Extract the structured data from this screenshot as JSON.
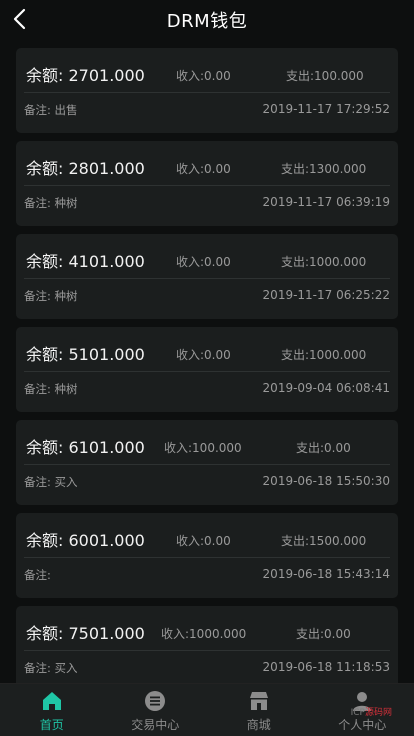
{
  "header": {
    "title": "DRM钱包"
  },
  "records": [
    {
      "balance_label": "余额:",
      "balance": "2701.000",
      "income_label": "收入:",
      "income": "0.00",
      "expense_label": "支出:",
      "expense": "100.000",
      "note_label": "备注:",
      "note": "出售",
      "time": "2019-11-17 17:29:52"
    },
    {
      "balance_label": "余额:",
      "balance": "2801.000",
      "income_label": "收入:",
      "income": "0.00",
      "expense_label": "支出:",
      "expense": "1300.000",
      "note_label": "备注:",
      "note": "种树",
      "time": "2019-11-17 06:39:19"
    },
    {
      "balance_label": "余额:",
      "balance": "4101.000",
      "income_label": "收入:",
      "income": "0.00",
      "expense_label": "支出:",
      "expense": "1000.000",
      "note_label": "备注:",
      "note": "种树",
      "time": "2019-11-17 06:25:22"
    },
    {
      "balance_label": "余额:",
      "balance": "5101.000",
      "income_label": "收入:",
      "income": "0.00",
      "expense_label": "支出:",
      "expense": "1000.000",
      "note_label": "备注:",
      "note": "种树",
      "time": "2019-09-04 06:08:41"
    },
    {
      "balance_label": "余额:",
      "balance": "6101.000",
      "income_label": "收入:",
      "income": "100.000",
      "expense_label": "支出:",
      "expense": "0.00",
      "note_label": "备注:",
      "note": "买入",
      "time": "2019-06-18 15:50:30"
    },
    {
      "balance_label": "余额:",
      "balance": "6001.000",
      "income_label": "收入:",
      "income": "0.00",
      "expense_label": "支出:",
      "expense": "1500.000",
      "note_label": "备注:",
      "note": "",
      "time": "2019-06-18 15:43:14"
    },
    {
      "balance_label": "余额:",
      "balance": "7501.000",
      "income_label": "收入:",
      "income": "1000.000",
      "expense_label": "支出:",
      "expense": "0.00",
      "note_label": "备注:",
      "note": "买入",
      "time": "2019-06-18 11:18:53"
    }
  ],
  "tabbar": {
    "items": [
      {
        "label": "首页",
        "icon": "home-icon",
        "active": true
      },
      {
        "label": "交易中心",
        "icon": "list-icon",
        "active": false
      },
      {
        "label": "商城",
        "icon": "shop-icon",
        "active": false
      },
      {
        "label": "个人中心",
        "icon": "user-icon",
        "active": false
      }
    ]
  },
  "watermark": {
    "text_a": "ICP",
    "text_b": "源码网"
  },
  "colors": {
    "accent": "#1fc6a6",
    "background": "#0d0f0f",
    "card": "#1b1e1e"
  }
}
